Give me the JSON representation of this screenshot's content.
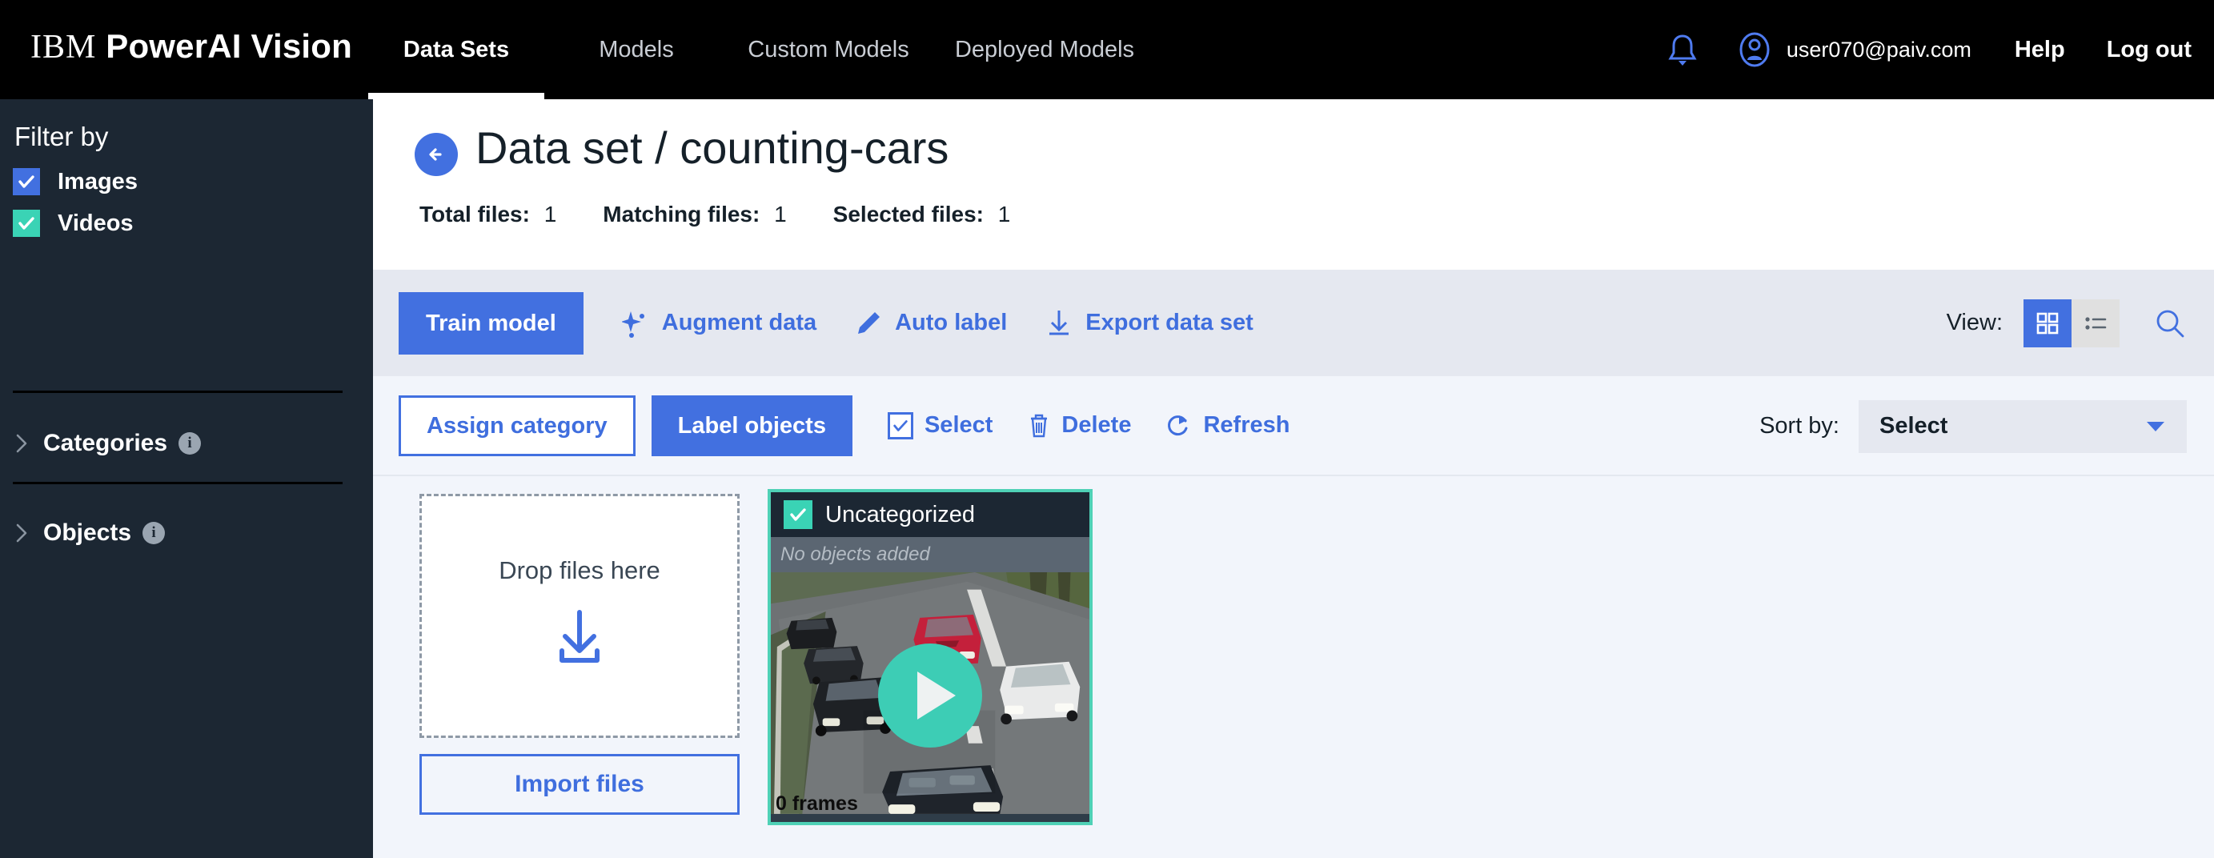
{
  "header": {
    "brand_ibm": "IBM",
    "brand_product": "PowerAI Vision",
    "nav": [
      {
        "label": "Data Sets",
        "active": true
      },
      {
        "label": "Models",
        "active": false
      },
      {
        "label": "Custom Models",
        "active": false
      },
      {
        "label": "Deployed Models",
        "active": false
      }
    ],
    "bell_icon": "notification-bell-icon",
    "avatar_icon": "user-avatar-icon",
    "user_email": "user070@paiv.com",
    "help_label": "Help",
    "logout_label": "Log out"
  },
  "sidebar": {
    "title": "Filter by",
    "filters": [
      {
        "label": "Images",
        "checked": true,
        "color": "#4270e0"
      },
      {
        "label": "Videos",
        "checked": true,
        "color": "#3ad3b5"
      }
    ],
    "sections": [
      {
        "label": "Categories",
        "expanded": false,
        "info": "i"
      },
      {
        "label": "Objects",
        "expanded": false,
        "info": "i"
      }
    ]
  },
  "page": {
    "back_icon": "back-arrow-icon",
    "title": "Data set / counting-cars",
    "counts": [
      {
        "label": "Total files:",
        "value": "1"
      },
      {
        "label": "Matching files:",
        "value": "1"
      },
      {
        "label": "Selected files:",
        "value": "1"
      }
    ]
  },
  "toolbar": {
    "train_label": "Train model",
    "actions": [
      {
        "label": "Augment data",
        "icon": "sparkle-icon"
      },
      {
        "label": "Auto label",
        "icon": "pencil-icon"
      },
      {
        "label": "Export data set",
        "icon": "download-icon"
      }
    ],
    "view_label": "View:",
    "view_grid_icon": "grid-view-icon",
    "view_list_icon": "list-view-icon",
    "search_icon": "search-icon"
  },
  "actionbar": {
    "assign_category_label": "Assign category",
    "label_objects_label": "Label objects",
    "select_label": "Select",
    "select_checked": true,
    "delete_label": "Delete",
    "delete_icon": "trash-icon",
    "refresh_label": "Refresh",
    "refresh_icon": "refresh-icon",
    "sort_by_label": "Sort by:",
    "sort_by_value": "Select",
    "sort_caret_icon": "chevron-down-icon"
  },
  "gallery": {
    "dropzone_text": "Drop files here",
    "dropzone_icon": "download-into-tray-icon",
    "import_label": "Import files",
    "cards": [
      {
        "category": "Uncategorized",
        "checked": true,
        "objects_text": "No objects added",
        "frames_text": "0 frames",
        "play_icon": "play-icon",
        "thumbnail": "highway-cars-video-thumbnail"
      }
    ]
  },
  "colors": {
    "accent_blue": "#4270e0",
    "accent_teal": "#3ad3b5",
    "header_black": "#000000",
    "sidebar_dark": "#1c2733",
    "toolbar1_bg": "#e5e8f0",
    "toolbar2_bg": "#f2f5fb"
  }
}
